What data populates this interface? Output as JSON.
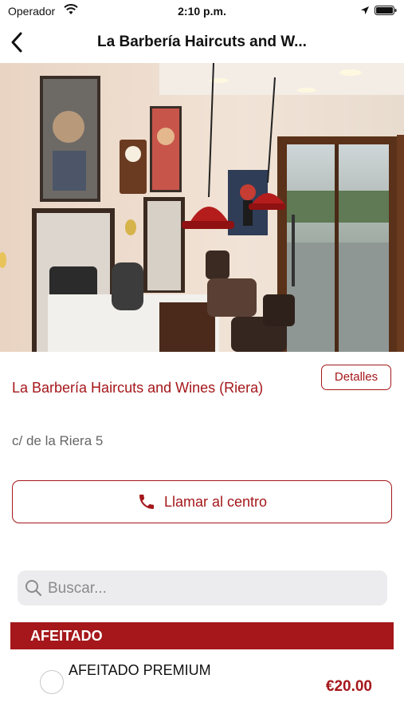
{
  "status_bar": {
    "carrier": "Operador",
    "time": "2:10 p.m.",
    "icons": [
      "wifi-icon",
      "location-arrow-icon",
      "battery-icon"
    ]
  },
  "nav": {
    "title": "La Barbería Haircuts and W...",
    "back_icon": "chevron-left-icon"
  },
  "hero": {
    "image": "barbershop-interior-photo"
  },
  "shop": {
    "name": "La Barbería Haircuts and Wines (Riera)",
    "address": "c/ de la Riera 5",
    "details_label": "Detalles"
  },
  "call": {
    "label": "Llamar al centro",
    "icon": "phone-icon"
  },
  "search": {
    "placeholder": "Buscar...",
    "value": "",
    "icon": "search-icon"
  },
  "services": {
    "category": "AFEITADO",
    "items": [
      {
        "name": "AFEITADO PREMIUM",
        "price": "€20.00",
        "selected": false
      }
    ]
  },
  "colors": {
    "accent": "#a5171b",
    "search_bg": "#ececee"
  }
}
